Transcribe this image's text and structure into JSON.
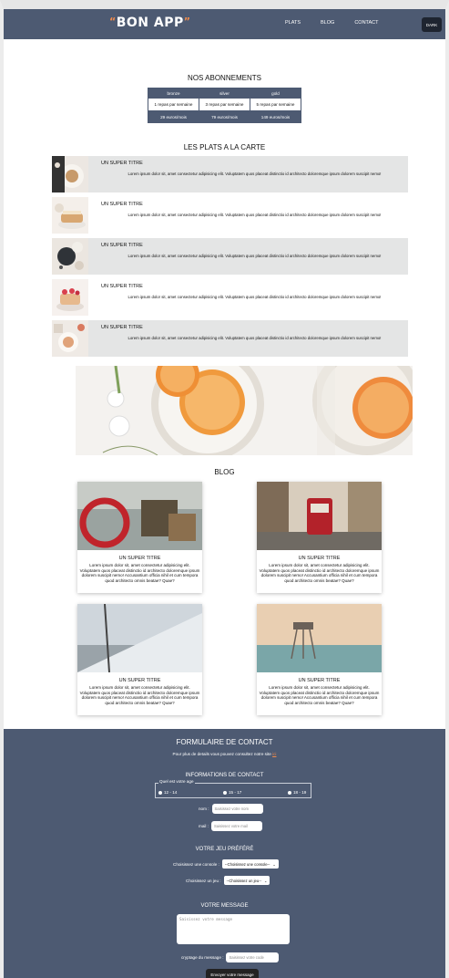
{
  "nav": {
    "logo_left_quote": "“",
    "logo_text": "BON APP",
    "logo_right_quote": "”",
    "links": [
      "PLATS",
      "BLOG",
      "CONTACT"
    ],
    "theme_button": "DARK"
  },
  "subscriptions": {
    "title": "NOS ABONNEMENTS",
    "columns": [
      "bronze",
      "silver",
      "gold"
    ],
    "meals": [
      "1 repas par semaine",
      "3 repas par semaine",
      "5 repas par semaine"
    ],
    "prices": [
      "29 euros/mois",
      "79 euros/mois",
      "149 euros/mois"
    ]
  },
  "plats": {
    "title": "LES PLATS A LA CARTE",
    "items": [
      {
        "title": "UN SUPER TITRE",
        "text": "Lorem ipsum dolor sit, amet consectetur adipisicing elit. Voluptatem quos placeat distinctio id architecto doloremque ipsum dolorem suscipit nemo!"
      },
      {
        "title": "UN SUPER TITRE",
        "text": "Lorem ipsum dolor sit, amet consectetur adipisicing elit. Voluptatem quos placeat distinctio id architecto doloremque ipsum dolorem suscipit nemo!"
      },
      {
        "title": "UN SUPER TITRE",
        "text": "Lorem ipsum dolor sit, amet consectetur adipisicing elit. Voluptatem quos placeat distinctio id architecto doloremque ipsum dolorem suscipit nemo!"
      },
      {
        "title": "UN SUPER TITRE",
        "text": "Lorem ipsum dolor sit, amet consectetur adipisicing elit. Voluptatem quos placeat distinctio id architecto doloremque ipsum dolorem suscipit nemo!"
      },
      {
        "title": "UN SUPER TITRE",
        "text": "Lorem ipsum dolor sit, amet consectetur adipisicing elit. Voluptatem quos placeat distinctio id architecto doloremque ipsum dolorem suscipit nemo!"
      }
    ]
  },
  "blog": {
    "title": "BLOG",
    "cards": [
      {
        "title": "UN SUPER TITRE",
        "text": "Lorem ipsum dolor sit, amet consectetur adipisicing elit. Voluptatem quos placeat distinctio id architecto doloremque ipsum dolorem suscipit nemo! Accusantium officia nihil et cum tempora quod architecto omnis beatae? Quae?"
      },
      {
        "title": "UN SUPER TITRE",
        "text": "Lorem ipsum dolor sit, amet consectetur adipisicing elit. Voluptatem quos placeat distinctio id architecto doloremque ipsum dolorem suscipit nemo! Accusantium officia nihil et cum tempora quod architecto omnis beatae? Quae?"
      },
      {
        "title": "UN SUPER TITRE",
        "text": "Lorem ipsum dolor sit, amet consectetur adipisicing elit. Voluptatem quos placeat distinctio id architecto doloremque ipsum dolorem suscipit nemo! Accusantium officia nihil et cum tempora quod architecto omnis beatae? Quae?"
      },
      {
        "title": "UN SUPER TITRE",
        "text": "Lorem ipsum dolor sit, amet consectetur adipisicing elit. Voluptatem quos placeat distinctio id architecto doloremque ipsum dolorem suscipit nemo! Accusantium officia nihil et cum tempora quod architecto omnis beatae? Quae?"
      }
    ]
  },
  "contact": {
    "title": "FORMULAIRE DE CONTACT",
    "subtitle": "Pour plus de details vous pouvez consultez notre site",
    "subtitle_link": "ici",
    "info_title": "INFORMATIONS DE CONTACT",
    "age_legend": "Quel est votre age",
    "age_options": [
      "12 - 14",
      "15 - 17",
      "18 - 19"
    ],
    "nom_label": "nom :",
    "nom_placeholder": "Saisissez votre nom",
    "mail_label": "mail :",
    "mail_placeholder": "Saisissez votre mail",
    "game_title": "VOTRE JEU PRÉFÉRÉ",
    "console_label": "Choisissez une console :",
    "console_value": "--Choisissez une console--",
    "jeu_label": "Choisissez un jeu :",
    "jeu_value": "--Choisissez un jeu--",
    "message_title": "VOTRE MESSAGE",
    "message_placeholder": "Saisissez votre message",
    "crypt_label": "cryptage du message :",
    "crypt_placeholder": "Saisissez votre code",
    "submit": "Envoyer votre message"
  },
  "colors": {
    "primary": "#4d5a72",
    "accent": "#f08a4b",
    "card_grey": "#e4e5e5"
  }
}
